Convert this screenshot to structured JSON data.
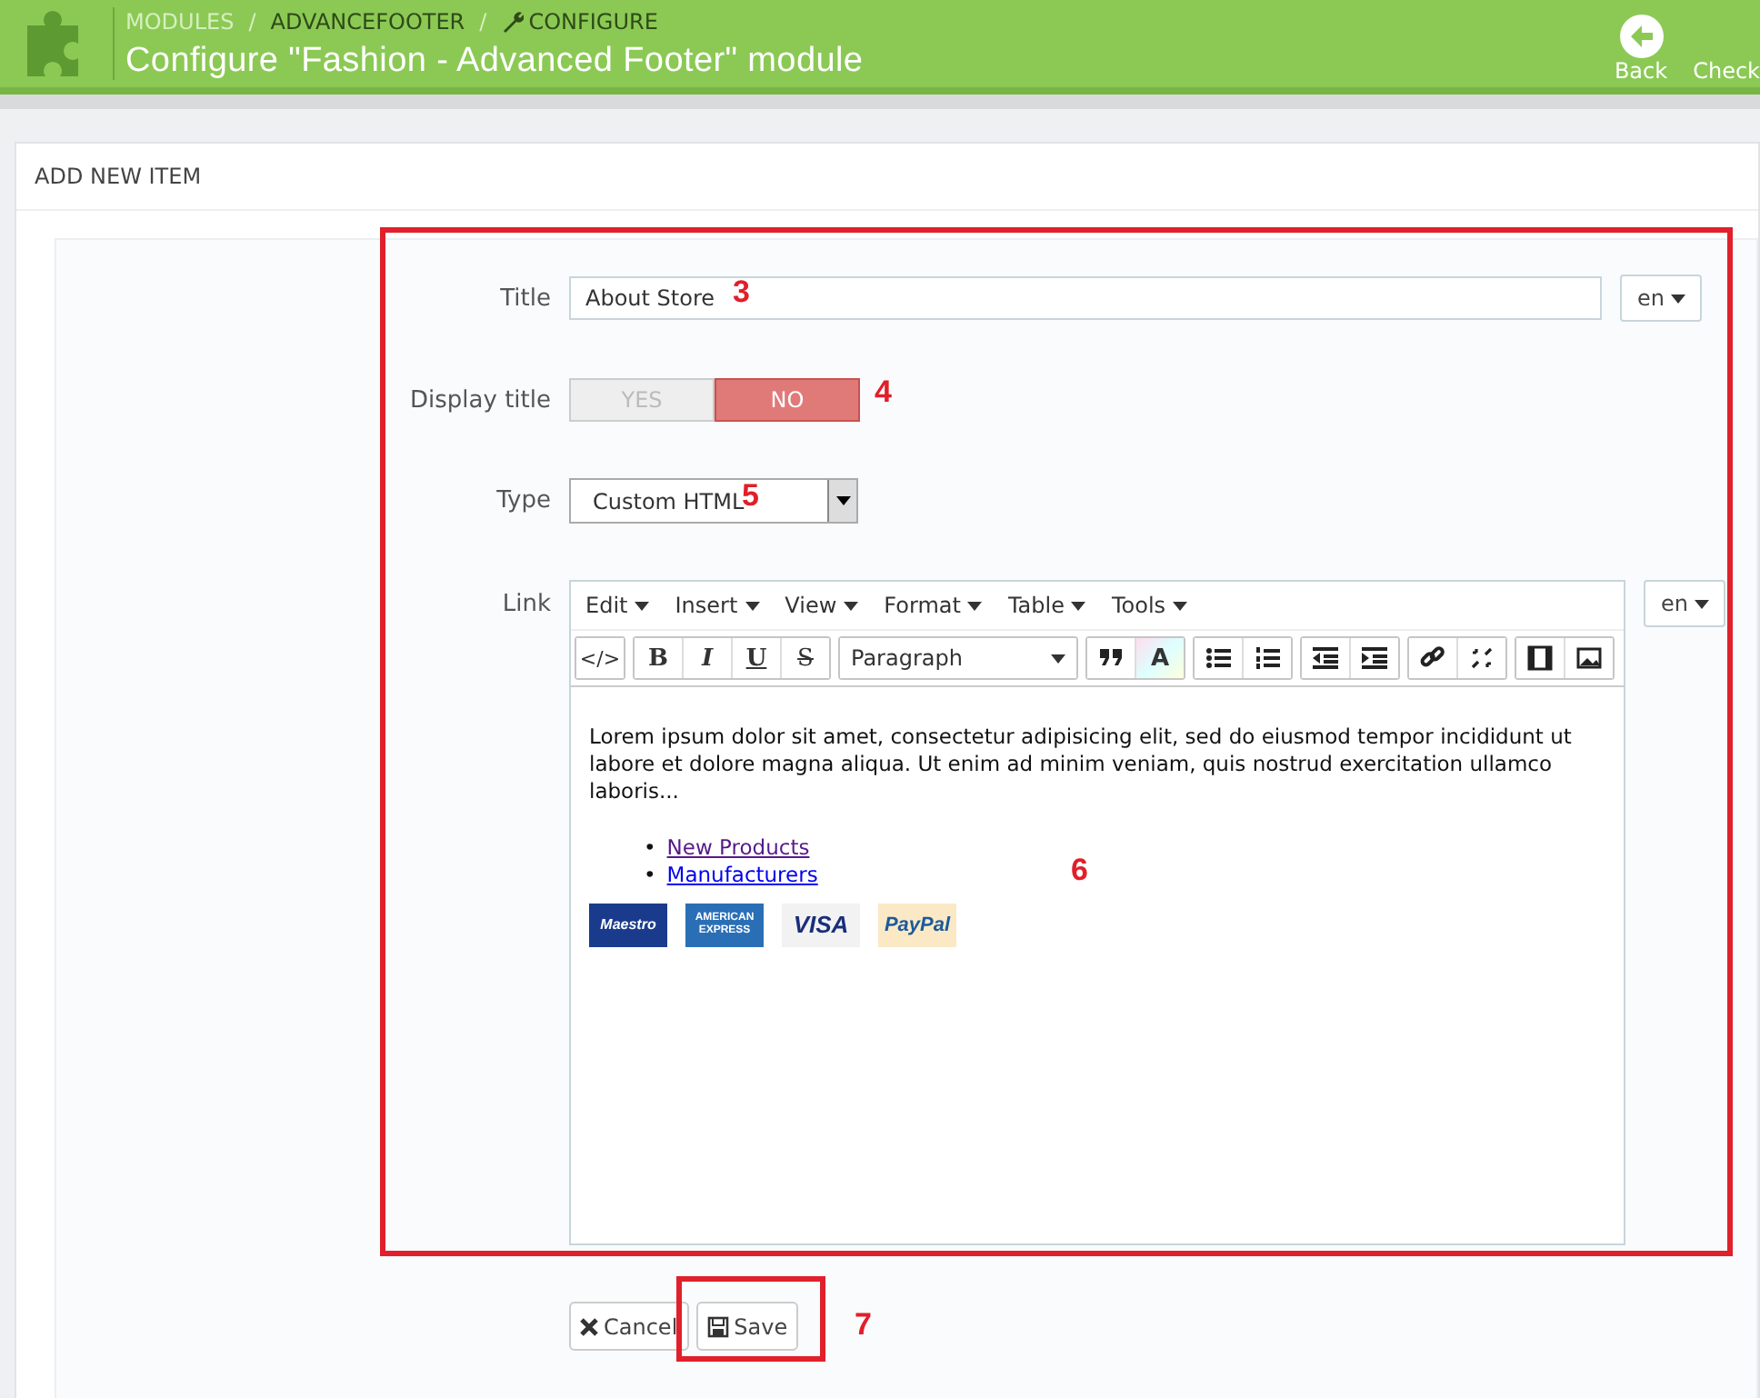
{
  "header": {
    "breadcrumb": [
      {
        "label": "MODULES",
        "kind": "link"
      },
      {
        "label": "/",
        "kind": "separator"
      },
      {
        "label": "ADVANCEFOOTER",
        "kind": "current"
      },
      {
        "label": "/",
        "kind": "separator"
      },
      {
        "label": "CONFIGURE",
        "kind": "wrench"
      }
    ],
    "title": "Configure \"Fashion - Advanced Footer\" module",
    "toolbar": [
      {
        "label": "Back",
        "kind": "back"
      },
      {
        "label": "Check",
        "kind": "plain"
      }
    ]
  },
  "panel": {
    "heading": "ADD NEW ITEM"
  },
  "form": {
    "title_field": {
      "label": "Title",
      "value": "About Store",
      "lang": "en"
    },
    "display_title": {
      "label": "Display title",
      "options": [
        {
          "label": "YES",
          "selected": false
        },
        {
          "label": "NO",
          "selected": true
        }
      ]
    },
    "type_field": {
      "label": "Type",
      "value": "Custom HTML"
    },
    "link_field": {
      "label": "Link",
      "lang": "en",
      "menu": [
        "Edit",
        "Insert",
        "View",
        "Format",
        "Table",
        "Tools"
      ],
      "tools": [
        {
          "kind": "code",
          "text": "</>"
        },
        {
          "kind": "bold",
          "text": "B"
        },
        {
          "kind": "italic",
          "text": "I"
        },
        {
          "kind": "underline",
          "text": "U"
        },
        {
          "kind": "strike",
          "text": "S"
        },
        {
          "kind": "select",
          "text": "Paragraph"
        },
        {
          "kind": "quote"
        },
        {
          "kind": "color",
          "text": "A"
        },
        {
          "kind": "bullets"
        },
        {
          "kind": "numbers"
        },
        {
          "kind": "outdent"
        },
        {
          "kind": "indent"
        },
        {
          "kind": "link"
        },
        {
          "kind": "unlink"
        },
        {
          "kind": "media"
        },
        {
          "kind": "image"
        }
      ],
      "content": {
        "paragraph": "Lorem ipsum dolor sit amet, consectetur adipisicing elit, sed do eiusmod tempor incididunt ut labore et dolore magna aliqua. Ut enim ad minim veniam, quis nostrud exercitation ullamco laboris...",
        "links": [
          {
            "bullet": "•",
            "label": "New Products",
            "visited": true
          },
          {
            "bullet": "•",
            "label": "Manufacturers",
            "visited": false
          }
        ],
        "cards": [
          {
            "kind": "maestro",
            "label": "Maestro"
          },
          {
            "kind": "amex",
            "label": "AMERICAN EXPRESS"
          },
          {
            "kind": "visa",
            "label": "VISA"
          },
          {
            "kind": "paypal",
            "label": "PayPal"
          }
        ]
      }
    }
  },
  "buttons": [
    {
      "label": "Cancel",
      "kind": "cancel"
    },
    {
      "label": "Save",
      "kind": "save"
    }
  ],
  "annotations": [
    {
      "kind": "frame"
    },
    {
      "kind": "frame"
    },
    {
      "kind": "number",
      "label": "3"
    },
    {
      "kind": "number",
      "label": "4"
    },
    {
      "kind": "number",
      "label": "5"
    },
    {
      "kind": "number",
      "label": "6"
    },
    {
      "kind": "number",
      "label": "7"
    }
  ]
}
